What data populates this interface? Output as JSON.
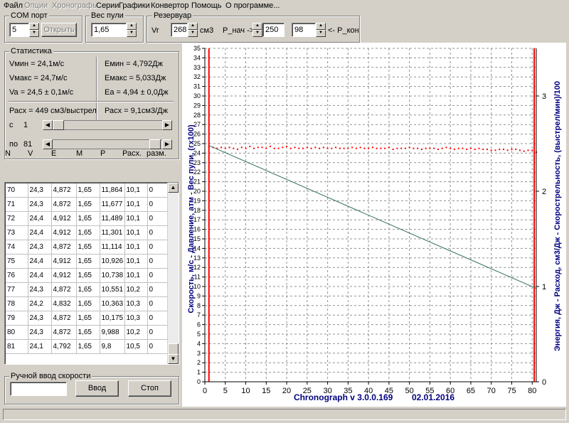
{
  "menu": [
    "Файл",
    "Опции",
    "Хронографы",
    "Серии",
    "Графики",
    "Конвертор",
    "Помощь",
    "О программе..."
  ],
  "com_port": {
    "title": "COM порт",
    "value": "5",
    "button": "Открыть"
  },
  "bullet_weight": {
    "title": "Вес пули",
    "value": "1,65"
  },
  "reservoir": {
    "title": "Резервуар",
    "vr_label": "Vr",
    "vr_value": "268",
    "vr_unit": "см3",
    "p_start_label": "P_нач ->",
    "p_start_value": "250",
    "p_end_value": "98",
    "p_end_label": "<- P_кон"
  },
  "statistics": {
    "title": "Статистика",
    "v_min": "Vмин = 24,1м/с",
    "v_max": "Vмакс = 24,7м/с",
    "v_avg": "Va = 24,5 ± 0,1м/с",
    "e_min": "Eмин = 4,792Дж",
    "e_max": "Eмакс = 5,033Дж",
    "e_avg": "Ea = 4,94 ± 0,0Дж",
    "consumption_shot": "Расх = 449 см3/выстрел",
    "consumption_j": "Расх = 9,1см3/Дж",
    "from_label": "с",
    "from_value": "1",
    "to_label": "по",
    "to_value": "81",
    "from_slider_fraction": 0.0,
    "to_slider_fraction": 1.0
  },
  "table": {
    "columns": [
      "N",
      "V",
      "E",
      "M",
      "P",
      "Расх.",
      "разм."
    ],
    "rows": [
      [
        "70",
        "24,3",
        "4,872",
        "1,65",
        "11,864",
        "10,1",
        "0"
      ],
      [
        "71",
        "24,3",
        "4,872",
        "1,65",
        "11,677",
        "10,1",
        "0"
      ],
      [
        "72",
        "24,4",
        "4,912",
        "1,65",
        "11,489",
        "10,1",
        "0"
      ],
      [
        "73",
        "24,4",
        "4,912",
        "1,65",
        "11,301",
        "10,1",
        "0"
      ],
      [
        "74",
        "24,3",
        "4,872",
        "1,65",
        "11,114",
        "10,1",
        "0"
      ],
      [
        "75",
        "24,4",
        "4,912",
        "1,65",
        "10,926",
        "10,1",
        "0"
      ],
      [
        "76",
        "24,4",
        "4,912",
        "1,65",
        "10,738",
        "10,1",
        "0"
      ],
      [
        "77",
        "24,3",
        "4,872",
        "1,65",
        "10,551",
        "10,2",
        "0"
      ],
      [
        "78",
        "24,2",
        "4,832",
        "1,65",
        "10,363",
        "10,3",
        "0"
      ],
      [
        "79",
        "24,3",
        "4,872",
        "1,65",
        "10,175",
        "10,3",
        "0"
      ],
      [
        "80",
        "24,3",
        "4,872",
        "1,65",
        "9,988",
        "10,2",
        "0"
      ],
      [
        "81",
        "24,1",
        "4,792",
        "1,65",
        "9,8",
        "10,5",
        "0"
      ]
    ]
  },
  "manual_input": {
    "title": "Ручной ввод скорости",
    "value": "",
    "enter_button": "Ввод",
    "stop_button": "Стоп"
  },
  "chart_data": {
    "type": "line",
    "title": "",
    "xlabel": "Chronograph v 3.0.0.169        02.01.2016",
    "ylabel": "Скорость, м/с  - Давление, атм - Вес пули, (гх100)",
    "y2label": "Энергия, Дж  - Расход, см3/Дж - Скорострельность, (выстрел/мин)/100",
    "xlim": [
      0,
      81
    ],
    "ylim": [
      0,
      35
    ],
    "y2lim": [
      0,
      3.5
    ],
    "x_ticks": [
      0,
      5,
      10,
      15,
      20,
      25,
      30,
      35,
      40,
      45,
      50,
      55,
      60,
      65,
      70,
      75,
      80
    ],
    "y_ticks": [
      0,
      1,
      2,
      3,
      4,
      5,
      6,
      7,
      8,
      9,
      10,
      11,
      12,
      13,
      14,
      15,
      16,
      17,
      18,
      19,
      20,
      21,
      22,
      23,
      24,
      25,
      26,
      27,
      28,
      29,
      30,
      31,
      32,
      33,
      34,
      35
    ],
    "y2_ticks": [
      0,
      1,
      2,
      3
    ],
    "grid": true,
    "colors": {
      "velocity": "#ff0000",
      "pressure": "#2f6f5f",
      "markers": "#ff0000"
    },
    "markers_x": [
      1,
      80.5
    ],
    "series": [
      {
        "kind": "scatter",
        "color": "#ff0000",
        "x": [
          1,
          2,
          3,
          4,
          5,
          6,
          7,
          8,
          9,
          10,
          11,
          12,
          13,
          14,
          15,
          16,
          17,
          18,
          19,
          20,
          21,
          22,
          23,
          24,
          25,
          26,
          27,
          28,
          29,
          30,
          31,
          32,
          33,
          34,
          35,
          36,
          37,
          38,
          39,
          40,
          41,
          42,
          43,
          44,
          45,
          46,
          47,
          48,
          49,
          50,
          51,
          52,
          53,
          54,
          55,
          56,
          57,
          58,
          59,
          60,
          61,
          62,
          63,
          64,
          65,
          66,
          67,
          68,
          69,
          70,
          71,
          72,
          73,
          74,
          75,
          76,
          77,
          78,
          79,
          80,
          81
        ],
        "values": [
          24.7,
          24.6,
          24.5,
          24.6,
          24.5,
          24.6,
          24.5,
          24.4,
          24.6,
          24.5,
          24.7,
          24.5,
          24.6,
          24.6,
          24.5,
          24.7,
          24.5,
          24.5,
          24.6,
          24.7,
          24.5,
          24.6,
          24.5,
          24.5,
          24.6,
          24.5,
          24.6,
          24.5,
          24.6,
          24.5,
          24.5,
          24.6,
          24.5,
          24.5,
          24.5,
          24.6,
          24.5,
          24.6,
          24.5,
          24.5,
          24.6,
          24.5,
          24.5,
          24.5,
          24.6,
          24.4,
          24.5,
          24.5,
          24.5,
          24.6,
          24.5,
          24.5,
          24.4,
          24.5,
          24.5,
          24.5,
          24.4,
          24.5,
          24.6,
          24.5,
          24.4,
          24.5,
          24.5,
          24.4,
          24.5,
          24.4,
          24.5,
          24.4,
          24.4,
          24.3,
          24.3,
          24.4,
          24.4,
          24.3,
          24.4,
          24.4,
          24.3,
          24.2,
          24.3,
          24.3,
          24.1
        ]
      },
      {
        "kind": "line",
        "color": "#2f6f5f",
        "x": [
          1,
          81
        ],
        "values": [
          24.8,
          9.8
        ]
      }
    ]
  }
}
